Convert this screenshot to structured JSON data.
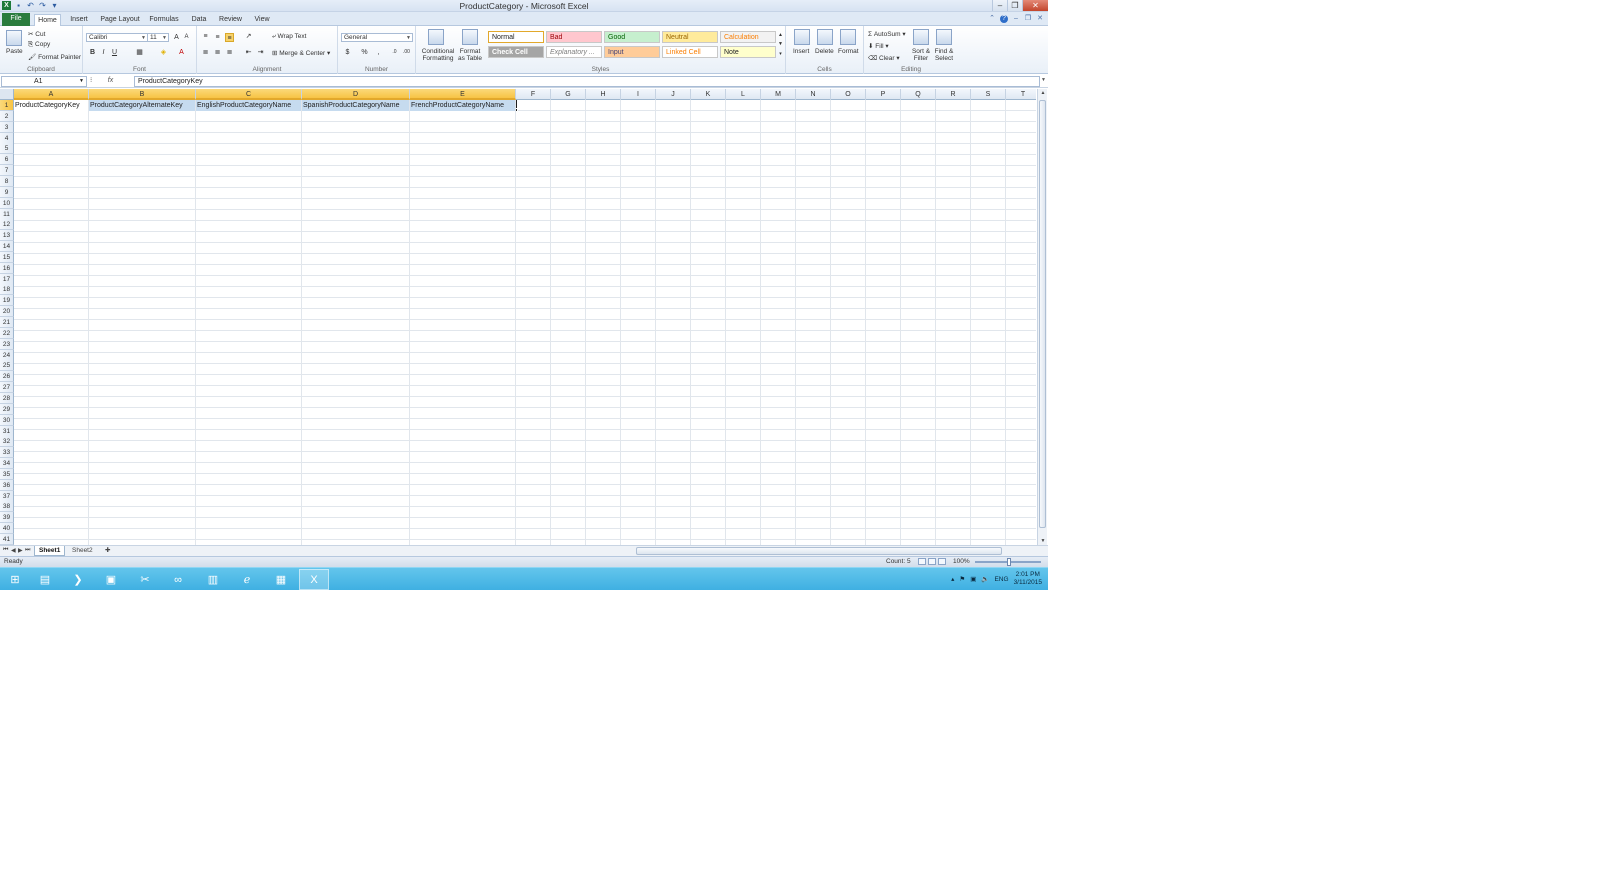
{
  "window": {
    "title": "ProductCategory - Microsoft Excel"
  },
  "tabs": [
    {
      "label": "File",
      "active": false
    },
    {
      "label": "Home",
      "active": true
    },
    {
      "label": "Insert",
      "active": false
    },
    {
      "label": "Page Layout",
      "active": false
    },
    {
      "label": "Formulas",
      "active": false
    },
    {
      "label": "Data",
      "active": false
    },
    {
      "label": "Review",
      "active": false
    },
    {
      "label": "View",
      "active": false
    }
  ],
  "ribbon": {
    "clipboard": {
      "paste": "Paste",
      "cut": "Cut",
      "copy": "Copy",
      "format_painter": "Format Painter",
      "label": "Clipboard"
    },
    "font": {
      "name": "Calibri",
      "size": "11",
      "label": "Font"
    },
    "alignment": {
      "wrap_text": "Wrap Text",
      "merge_center": "Merge & Center",
      "label": "Alignment"
    },
    "number": {
      "format": "General",
      "label": "Number"
    },
    "styles": {
      "label": "Styles",
      "conditional": "Conditional Formatting",
      "format_table": "Format as Table",
      "items": [
        {
          "label": "Normal",
          "bg": "#ffffff",
          "fg": "#222222"
        },
        {
          "label": "Bad",
          "bg": "#ffc7ce",
          "fg": "#9c0006"
        },
        {
          "label": "Good",
          "bg": "#c6efce",
          "fg": "#006100"
        },
        {
          "label": "Neutral",
          "bg": "#ffeb9c",
          "fg": "#9c6500"
        },
        {
          "label": "Calculation",
          "bg": "#f2f2f2",
          "fg": "#fa7d00"
        },
        {
          "label": "Check Cell",
          "bg": "#a5a5a5",
          "fg": "#ffffff"
        },
        {
          "label": "Explanatory ...",
          "bg": "#ffffff",
          "fg": "#7f7f7f"
        },
        {
          "label": "Input",
          "bg": "#ffcc99",
          "fg": "#3f3f76"
        },
        {
          "label": "Linked Cell",
          "bg": "#ffffff",
          "fg": "#fa7d00"
        },
        {
          "label": "Note",
          "bg": "#ffffcc",
          "fg": "#222222"
        }
      ]
    },
    "cells": {
      "insert": "Insert",
      "delete": "Delete",
      "format": "Format",
      "label": "Cells"
    },
    "editing": {
      "autosum": "AutoSum",
      "fill": "Fill",
      "clear": "Clear",
      "sort_filter": "Sort & Filter",
      "find_select": "Find & Select",
      "label": "Editing"
    }
  },
  "formula_bar": {
    "name_box": "A1",
    "fx": "fx",
    "content": "ProductCategoryKey"
  },
  "grid": {
    "columns": [
      "A",
      "B",
      "C",
      "D",
      "E",
      "F",
      "G",
      "H",
      "I",
      "J",
      "K",
      "L",
      "M",
      "N",
      "O",
      "P",
      "Q",
      "R",
      "S",
      "T"
    ],
    "rows": [
      "1",
      "2",
      "3",
      "4",
      "5",
      "6",
      "7",
      "8",
      "9",
      "10",
      "11",
      "12",
      "13",
      "14",
      "15",
      "16",
      "17",
      "18",
      "19",
      "20",
      "21",
      "22",
      "23",
      "24",
      "25",
      "26",
      "27",
      "28",
      "29",
      "30",
      "31",
      "32",
      "33",
      "34",
      "35",
      "36",
      "37",
      "38",
      "39",
      "40",
      "41"
    ],
    "header_cells": [
      "ProductCategoryKey",
      "ProductCategoryAlternateKey",
      "EnglishProductCategoryName",
      "SpanishProductCategoryName",
      "FrenchProductCategoryName"
    ]
  },
  "sheets": [
    {
      "label": "Sheet1",
      "active": true
    },
    {
      "label": "Sheet2",
      "active": false
    }
  ],
  "status": {
    "ready": "Ready",
    "count": "Count: 5",
    "zoom": "100%"
  },
  "taskbar": {
    "time": "2:01 PM",
    "date": "3/11/2015",
    "lang": "ENG"
  }
}
